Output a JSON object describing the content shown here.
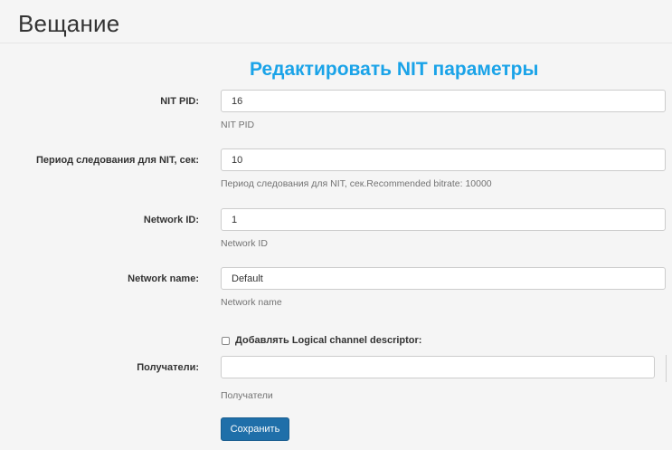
{
  "page": {
    "title": "Вещание"
  },
  "form": {
    "title": "Редактировать NIT параметры",
    "fields": [
      {
        "label": "NIT PID:",
        "value": "16",
        "help": "NIT PID"
      },
      {
        "label": "Период следования для NIT, сек:",
        "value": "10",
        "help": "Период следования для NIT, сек.Recommended bitrate: 10000"
      },
      {
        "label": "Network ID:",
        "value": "1",
        "help": "Network ID"
      },
      {
        "label": "Network name:",
        "value": "Default",
        "help": "Network name"
      }
    ],
    "lcd_checkbox": {
      "label": "Добавлять Logical channel descriptor:",
      "checked": false
    },
    "recipients": {
      "label": "Получатели:",
      "value": "",
      "help": "Получатели"
    },
    "save_label": "Сохранить"
  },
  "colors": {
    "accent_title": "#1aa3e8",
    "button": "#1f6fa9",
    "background": "#f5f5f5"
  }
}
